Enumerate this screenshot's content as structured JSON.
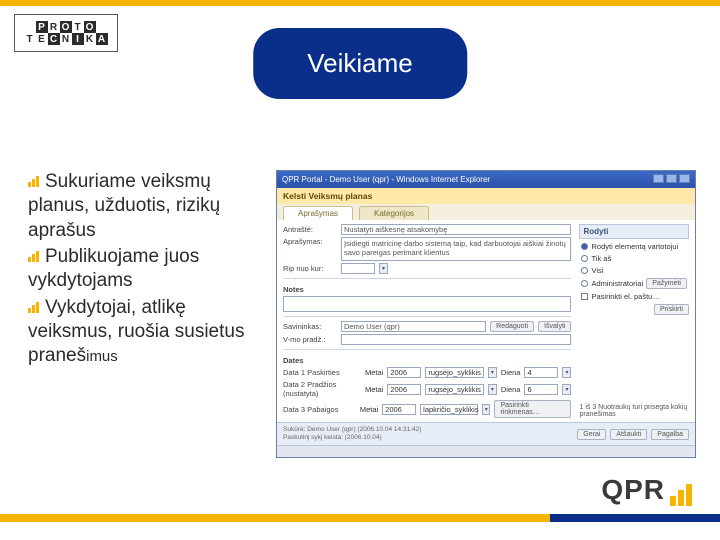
{
  "slide": {
    "title": "Veikiame",
    "logo_top": "PROTO",
    "logo_bottom": "TECNIKA",
    "qpr": "QPR"
  },
  "bullets": {
    "b1_lead": "Sukuriame",
    "b1_rest": "veiksmų planus, užduotis, rizikų aprašus",
    "b2_lead": "Publikuojame juos",
    "b2_rest": "vykdytojams",
    "b3_lead": "Vykdytojai, atlikę",
    "b3_rest": "veiksmus, ruošia susietus praneš",
    "b3_tail": "imus"
  },
  "shot": {
    "window_title": "QPR Portal - Demo User (qpr) - Windows Internet Explorer",
    "breadcrumb": "Kelsti Veiksmų planas",
    "tab1": "Aprašymas",
    "tab2": "Kategorijos",
    "lab_antraste": "Antraštė:",
    "val_antraste": "Nustatyti aiškesnę atsakomybę",
    "lab_apras": "Aprašymas:",
    "val_apras": "Įsidiegti matricinę darbo sistemą taip, kad darbuotojai aiškiai žinotų savo pareigas perimant klientus",
    "lab_nuo": "Rip nuo kur:",
    "right_head": "Rodyti",
    "r1": "Rodyti elementą vartotojui",
    "r2": "Tik aš",
    "r3": "Visi",
    "r4": "Administratoriai",
    "r5": "Pasirinkti el. paštu…",
    "btn_mark": "Pažymėti",
    "btn_send": "Priskirti",
    "notes_head": "Notes",
    "lab_savininkas": "Savininkas:",
    "val_savininkas": "Demo User (qpr)",
    "lab_vstart": "V-mo pradž.:",
    "btn_edit": "Redaguoti",
    "btn_clear": "Išvalyti",
    "dates_head": "Dates",
    "lab_d1": "Data 1 Paskirties",
    "lab_d2": "Data 2 Pradžios (nustatyta)",
    "lab_d3": "Data 3 Pabaigos",
    "metai": "Metai",
    "y2006": "2006",
    "m_rug": "rugsėjo_syklikis",
    "m_lap": "lapkričio_syklikis",
    "diena": "Diena",
    "d4": "4",
    "d6": "6",
    "right_note": "1 iš 3 Nuotraukų turi prisegta kokių pranešimas",
    "btn_select": "Pasirinkti rinkmenas…",
    "footer_created_lab": "Sukūrė:",
    "footer_created_val": "Demo User (qpr)   (2006.10.04 14:31:42)",
    "footer_changed": "Paskutinį sykį keista:  (2006.10.04)",
    "btn_save": "Gerai",
    "btn_cancel": "Atšaukti",
    "btn_help": "Pagalba"
  }
}
